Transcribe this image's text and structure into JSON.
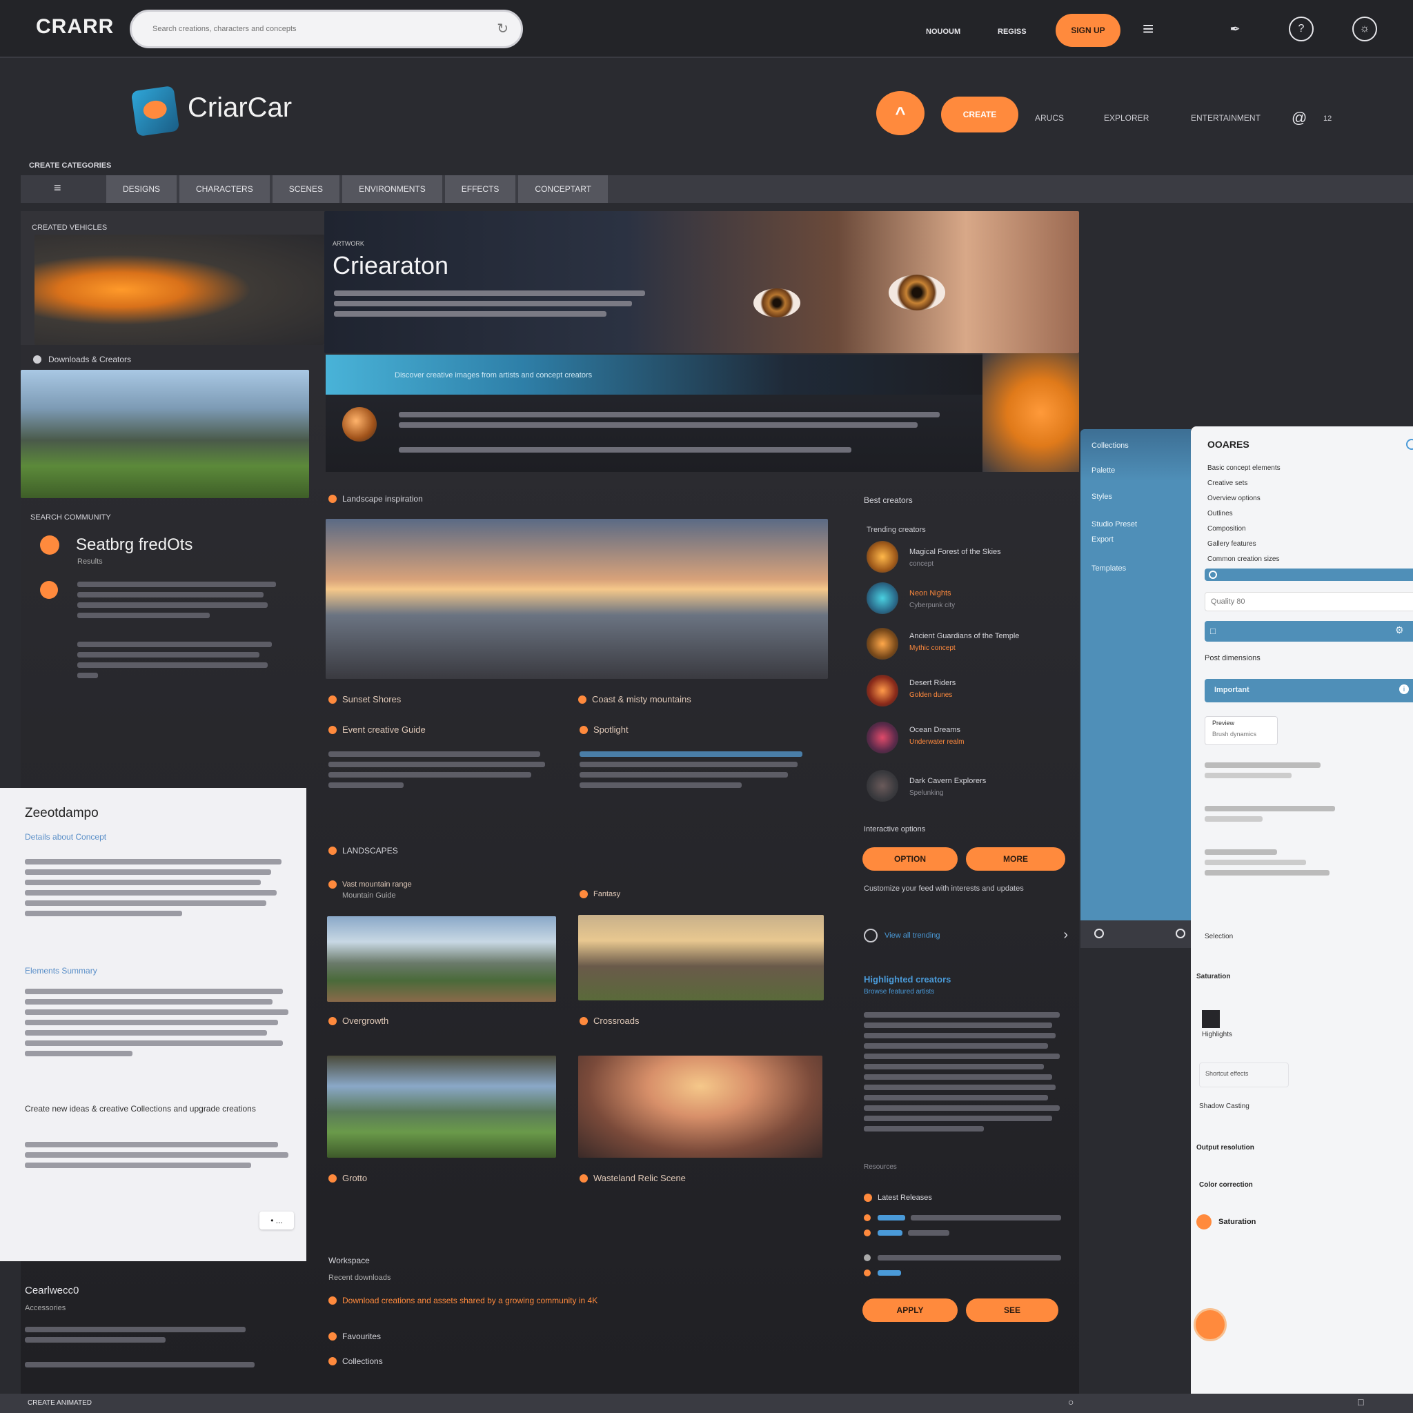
{
  "topbar": {
    "logo": "CRARR",
    "search_placeholder": "Search creations, characters and concepts",
    "links": [
      "NOUOUM",
      "REGISS"
    ],
    "cta": "SIGN UP",
    "icons": [
      "menu-icon",
      "feather-icon",
      "help-icon",
      "globe-icon"
    ]
  },
  "brand": {
    "name": "CriarCar",
    "fab_label": "^",
    "pill_label": "CREATE",
    "links": [
      "ARUCS",
      "EXPLORER",
      "ENTERTAINMENT"
    ],
    "badge": "12"
  },
  "section_label": "CREATE CATEGORIES",
  "tabs": [
    "DESIGNS",
    "CHARACTERS",
    "SCENES",
    "ENVIRONMENTS",
    "EFFECTS",
    "CONCEPTART"
  ],
  "left": {
    "card1_label": "CREATED VEHICLES",
    "card2_label": "Downloads & Creators",
    "section_label": "SEARCH COMMUNITY",
    "feature_title": "Seatbrg fredOts",
    "feature_sub": "Results",
    "panel": {
      "title": "Zeeotdampo",
      "link1": "Details about Concept",
      "link2": "Elements Summary",
      "quote": "Create new ideas & creative Collections and upgrade creations",
      "button": "• ..."
    },
    "footer_title": "Cearlwecc0",
    "footer_sub": "Accessories"
  },
  "hero": {
    "kicker": "ARTWORK",
    "title": "Criearaton",
    "banner_text": "Discover creative images from artists and concept creators",
    "avatar_icon": "planet-icon"
  },
  "gallery": {
    "section1": "Landscape inspiration",
    "cap1": "Sunset Shores",
    "cap2": "Coast & misty mountains",
    "sub1": "Event creative Guide",
    "sub2": "Spotlight",
    "section2": "LANDSCAPES",
    "sub3": "Vast mountain range",
    "sub3b": "Mountain Guide",
    "sub4": "Fantasy",
    "cap3": "Overgrowth",
    "cap4": "Crossroads",
    "cap5": "Grotto",
    "cap6": "Wasteland Relic Scene",
    "footer_label": "Workspace",
    "footer_sub": "Recent downloads",
    "footer_item1": "Download creations and assets shared by a growing community in 4K",
    "footer_item2": "Favourites",
    "footer_item3": "Collections"
  },
  "sidefeed": {
    "title": "Best creators",
    "subtitle": "Trending creators",
    "items": [
      {
        "title": "Magical Forest of the Skies",
        "sub": "concept"
      },
      {
        "title": "Neon Nights",
        "sub": "Cyberpunk city"
      },
      {
        "title": "Ancient Guardians of the Temple",
        "sub": "Mythic concept"
      },
      {
        "title": "Desert Riders",
        "sub": "Golden dunes"
      },
      {
        "title": "Ocean Dreams",
        "sub": "Underwater realm"
      },
      {
        "title": "Dark Cavern Explorers",
        "sub": "Spelunking"
      }
    ],
    "actions_label": "Interactive options",
    "btn1": "OPTION",
    "btn2": "MORE",
    "note": "Customize your feed with interests and updates",
    "link": "View all trending",
    "heading": "Highlighted creators",
    "heading_sub": "Browse featured artists",
    "tag_label": "Resources",
    "list_header": "Latest Releases",
    "btn3": "APPLY",
    "btn4": "SEE"
  },
  "bluepanel": {
    "items": [
      "Collections",
      "Palette",
      "Styles",
      "Studio Preset",
      "Export",
      "Templates"
    ]
  },
  "whitepanel": {
    "title": "OOARES",
    "items": [
      "Basic concept elements",
      "Creative sets",
      "Overview options",
      "Outlines",
      "Composition",
      "Gallery features",
      "Common creation sizes"
    ],
    "input_placeholder": "Quality 80",
    "subhead": "Post dimensions",
    "bar_label": "Important",
    "foot1": "Preview",
    "foot2": "Brush dynamics",
    "foot3": "Selection",
    "foot4": "Saturation",
    "foot5": "Highlights",
    "foot6": "Shortcut effects",
    "foot7": "Shadow Casting",
    "foot8": "Output resolution",
    "foot9": "Color correction"
  },
  "statusbar": {
    "text": "CREATE ANIMATED"
  }
}
